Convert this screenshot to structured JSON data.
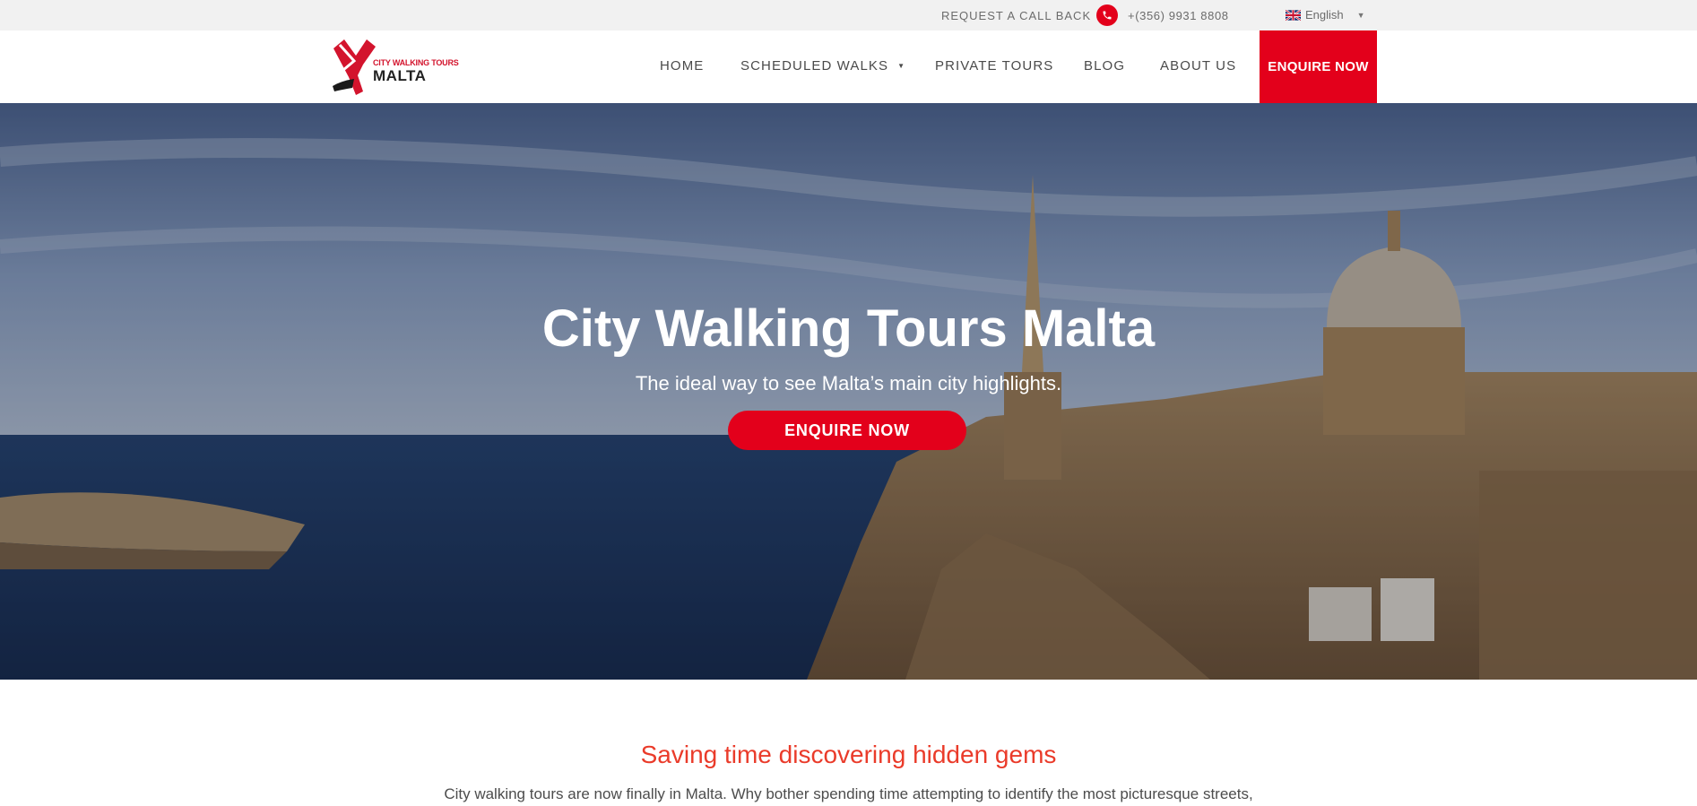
{
  "topbar": {
    "callback_label": "REQUEST A CALL BACK",
    "phone": "+(356) 9931 8808",
    "language": "English"
  },
  "header": {
    "logo": {
      "line1": "CITY WALKING TOURS",
      "line2": "MALTA"
    },
    "nav": [
      {
        "label": "HOME"
      },
      {
        "label": "SCHEDULED WALKS"
      },
      {
        "label": "PRIVATE TOURS"
      },
      {
        "label": "BLOG"
      },
      {
        "label": "ABOUT US"
      }
    ],
    "cta_label": "ENQUIRE NOW"
  },
  "hero": {
    "title": "City Walking Tours Malta",
    "subtitle": "The ideal way to see Malta’s main city highlights.",
    "button_label": "ENQUIRE NOW"
  },
  "intro": {
    "heading": "Saving time discovering hidden gems",
    "text": "City walking tours are now finally in Malta.  Why bother spending time attempting to identify the most picturesque streets,"
  },
  "colors": {
    "brand_red": "#e3001b",
    "heading_red": "#ea3b2a",
    "topbar_bg": "#f1f1f1"
  },
  "icons": [
    "phone-icon",
    "uk-flag-icon",
    "chevron-down-icon"
  ]
}
